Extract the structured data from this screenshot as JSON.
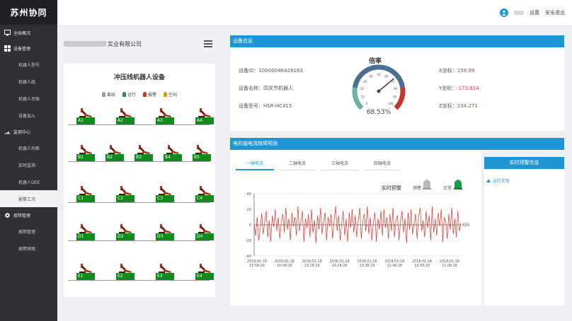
{
  "app": {
    "title": "苏州协同"
  },
  "sidebar": {
    "items": [
      {
        "label": "全局概况",
        "icon": "monitor-icon",
        "type": "group"
      },
      {
        "label": "设备管理",
        "icon": "grid-icon",
        "type": "group"
      },
      {
        "label": "机器人型号",
        "type": "sub"
      },
      {
        "label": "机器人组",
        "type": "sub"
      },
      {
        "label": "机器人台账",
        "type": "sub"
      },
      {
        "label": "设备加入",
        "type": "sub"
      },
      {
        "label": "监测中心",
        "icon": "gauge-icon",
        "type": "group"
      },
      {
        "label": "机器人列表",
        "type": "sub"
      },
      {
        "label": "实时监测",
        "type": "sub"
      },
      {
        "label": "机器人OEE",
        "type": "sub"
      },
      {
        "label": "报警工况",
        "type": "sub",
        "active": true
      },
      {
        "label": "故障管理",
        "icon": "gear-icon",
        "type": "group"
      },
      {
        "label": "故障管理",
        "type": "sub"
      },
      {
        "label": "故障预测",
        "type": "sub"
      }
    ]
  },
  "topbar": {
    "settings": "设置",
    "logout": "安全退出"
  },
  "company": {
    "name_suffix": "实业有限公司"
  },
  "left_panel": {
    "title": "冲压线机器人设备",
    "legend": [
      {
        "label": "离线",
        "color": "#9a9a9a"
      },
      {
        "label": "运行",
        "color": "#2e8b57"
      },
      {
        "label": "报警",
        "color": "#c0392b"
      },
      {
        "label": "空闲",
        "color": "#d59a1b"
      }
    ],
    "rows": [
      [
        "A1",
        "A2",
        "A3",
        "A4"
      ],
      [
        "B1",
        "B2",
        "B3",
        "B4",
        "B5"
      ],
      [
        "C1",
        "C2",
        "C3",
        "C4"
      ],
      [
        "D1",
        "D2",
        "D3",
        "D4"
      ],
      [
        "E1",
        "E2",
        "E3",
        "E4"
      ]
    ]
  },
  "device_info": {
    "header": "设备信息",
    "id_label": "设备ID：",
    "id_value": "10000048428183",
    "name_label": "设备名称：",
    "name_value": "四关节机器人",
    "model_label": "设备型号：",
    "model_value": "HSR-HC415",
    "x_label": "X坐标：",
    "x_value": "158.99",
    "y_label": "Y坐标：",
    "y_value": "-173.814",
    "z_label": "Z坐标：",
    "z_value": "234.271",
    "gauge_title": "倍率",
    "gauge_value": "68.53%",
    "gauge_percent": 68.53,
    "gauge_ticks": [
      "0",
      "10",
      "20",
      "30",
      "40",
      "50",
      "60",
      "70",
      "80",
      "90",
      "100"
    ]
  },
  "current": {
    "header": "电机轴电流故障预测",
    "tabs": [
      "一轴电流",
      "二轴电流",
      "三轴电流",
      "四轴电流"
    ],
    "realtime_label": "实时预警",
    "warn_label": "预警",
    "normal_label": "正常",
    "time_axis": "时间"
  },
  "alert": {
    "header": "实时预警信息",
    "status": "运行正常"
  },
  "chart_data": {
    "type": "line",
    "ylim": [
      -40,
      40
    ],
    "yticks": [
      40,
      20,
      0,
      -20,
      -40
    ],
    "xticks": [
      [
        "2018-01-18",
        "15:58:29"
      ],
      [
        "2018-01-18",
        "16:08:28"
      ],
      [
        "2018-01-18",
        "13:18:29"
      ],
      [
        "2018-01-18",
        "14:28:28"
      ],
      [
        "2018-01-18",
        "13:38:29"
      ],
      [
        "2018-01-18",
        "12:48:28"
      ],
      [
        "2018-01-18",
        "13:58:29"
      ],
      [
        "2018-01-18",
        "11:08:28"
      ]
    ],
    "series": [
      {
        "color": "#e0322b",
        "values": [
          2,
          -14,
          10,
          -20,
          -6,
          15,
          -12,
          3,
          18,
          -16,
          6,
          -22,
          12,
          -3,
          20,
          -8,
          10,
          -18,
          4,
          14,
          -10,
          22,
          -6,
          8,
          -20,
          16,
          -2,
          10,
          -14,
          24,
          -8,
          4,
          18,
          -22,
          8,
          -4,
          14,
          -16,
          20,
          -10,
          6,
          -24,
          12,
          -6,
          22,
          -12,
          4,
          16,
          -20,
          10,
          -2,
          14,
          -18,
          6,
          24,
          -8,
          12,
          -20,
          2,
          18,
          -14,
          8,
          -22,
          16,
          -4,
          20,
          -10,
          12,
          -16,
          6,
          22,
          -18,
          4,
          14,
          -8,
          24,
          -12,
          10,
          -20,
          2,
          16,
          -22,
          8,
          -6,
          18,
          -14,
          20,
          -4,
          10,
          -18,
          14,
          -8,
          22,
          -16,
          6,
          12,
          -20,
          4,
          18,
          -10,
          8,
          -24,
          16,
          -6,
          20,
          -12,
          2,
          14,
          -18,
          10,
          22,
          -8,
          6,
          -16,
          18,
          -4,
          12,
          -20,
          24,
          -10,
          8,
          -14,
          16,
          -2,
          20,
          -22,
          10,
          4,
          -18,
          14,
          -6,
          22,
          -12,
          8,
          -16,
          18,
          -8,
          2
        ]
      }
    ]
  }
}
